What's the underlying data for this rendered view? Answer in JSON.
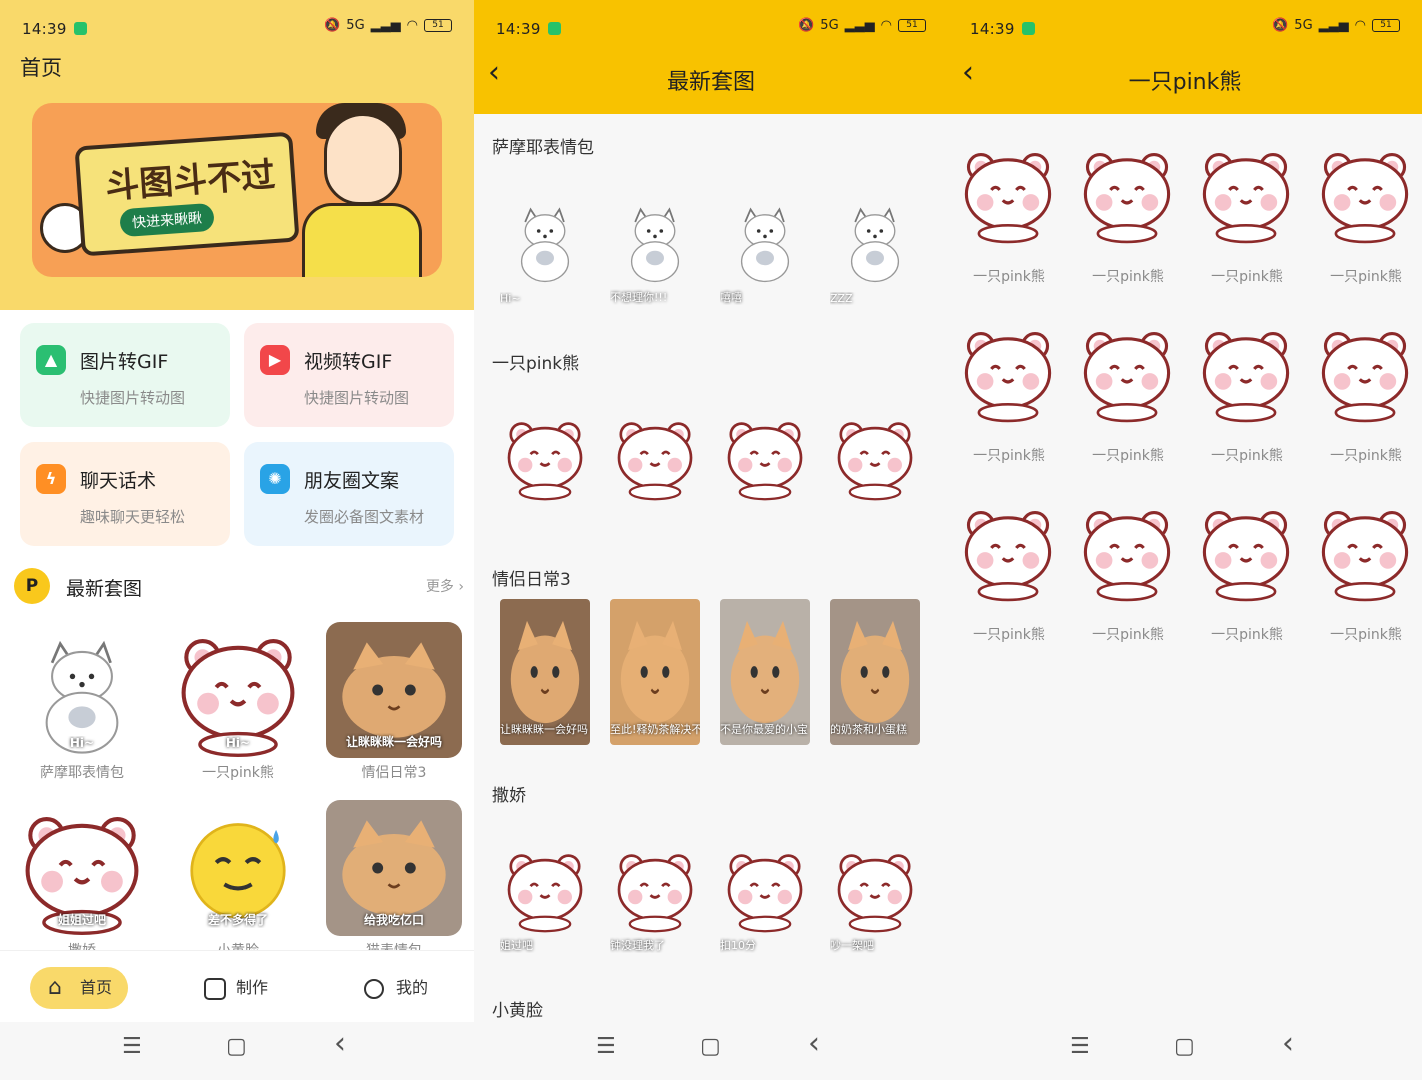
{
  "status": {
    "time": "14:39",
    "network": "5G",
    "battery": "51"
  },
  "home": {
    "title": "首页",
    "banner": {
      "headline": "斗图斗不过",
      "pill": "快进来瞅瞅"
    },
    "features": [
      {
        "title": "图片转GIF",
        "subtitle": "快捷图片转动图",
        "icon": "image-icon",
        "bg": "#e9f9f0",
        "iconColor": "#2bbf72"
      },
      {
        "title": "视频转GIF",
        "subtitle": "快捷图片转动图",
        "icon": "video-play-icon",
        "bg": "#fdeceb",
        "iconColor": "#f2474a"
      },
      {
        "title": "聊天话术",
        "subtitle": "趣味聊天更轻松",
        "icon": "lightning-icon",
        "bg": "#fff1e5",
        "iconColor": "#ff8f24"
      },
      {
        "title": "朋友圈文案",
        "subtitle": "发圈必备图文素材",
        "icon": "aperture-icon",
        "bg": "#eaf5fd",
        "iconColor": "#29a3e6"
      }
    ],
    "section": {
      "badge": "P",
      "title": "最新套图",
      "more": "更多"
    },
    "sets": [
      {
        "caption": "萨摩耶表情包",
        "art_text": "Hi~",
        "kind": "dog"
      },
      {
        "caption": "一只pink熊",
        "art_text": "Hi~",
        "kind": "bear"
      },
      {
        "caption": "情侣日常3",
        "art_text": "让眯眯眯一会好吗",
        "kind": "cat"
      },
      {
        "caption": "撒娇",
        "art_text": "姐姐过吧",
        "kind": "bear"
      },
      {
        "caption": "小黄脸",
        "art_text": "差不多得了",
        "kind": "emoji"
      },
      {
        "caption": "猫表情包",
        "art_text": "给我吃亿口",
        "kind": "cat"
      }
    ],
    "nav": [
      {
        "label": "首页",
        "icon": "home-icon"
      },
      {
        "label": "制作",
        "icon": "create-icon"
      },
      {
        "label": "我的",
        "icon": "profile-icon"
      }
    ]
  },
  "latest": {
    "title": "最新套图",
    "sections": [
      {
        "title": "萨摩耶表情包",
        "stickers": [
          "Hi~",
          "不想理你!!!",
          "嘻嘻",
          "ZZZ"
        ]
      },
      {
        "title": "一只pink熊",
        "stickers": [
          "",
          "",
          "",
          ""
        ]
      },
      {
        "title": "情侣日常3",
        "stickers": [
          "让眯眯眯一会好吗",
          "至此!释奶茶解决不",
          "不是你最爱的小宝",
          "的奶茶和小蛋糕"
        ]
      },
      {
        "title": "撒娇",
        "stickers": [
          "姐过吧",
          "钟没理我了",
          "扣10分",
          "吵一架吧"
        ]
      },
      {
        "title": "小黄脸",
        "stickers": []
      }
    ]
  },
  "detail": {
    "title": "一只pink熊",
    "items": [
      "一只pink熊",
      "一只pink熊",
      "一只pink熊",
      "一只pink熊",
      "一只pink熊",
      "一只pink熊",
      "一只pink熊",
      "一只pink熊",
      "一只pink熊",
      "一只pink熊",
      "一只pink熊",
      "一只pink熊"
    ]
  },
  "sys_nav": {
    "menu": "☰",
    "home": "▢",
    "back": "‹"
  },
  "colors": {
    "yellow": "#f8c200",
    "home_yellow": "#f9d96a",
    "bear_outline": "#8c2a2a",
    "bear_pink": "#f6c3cc"
  }
}
